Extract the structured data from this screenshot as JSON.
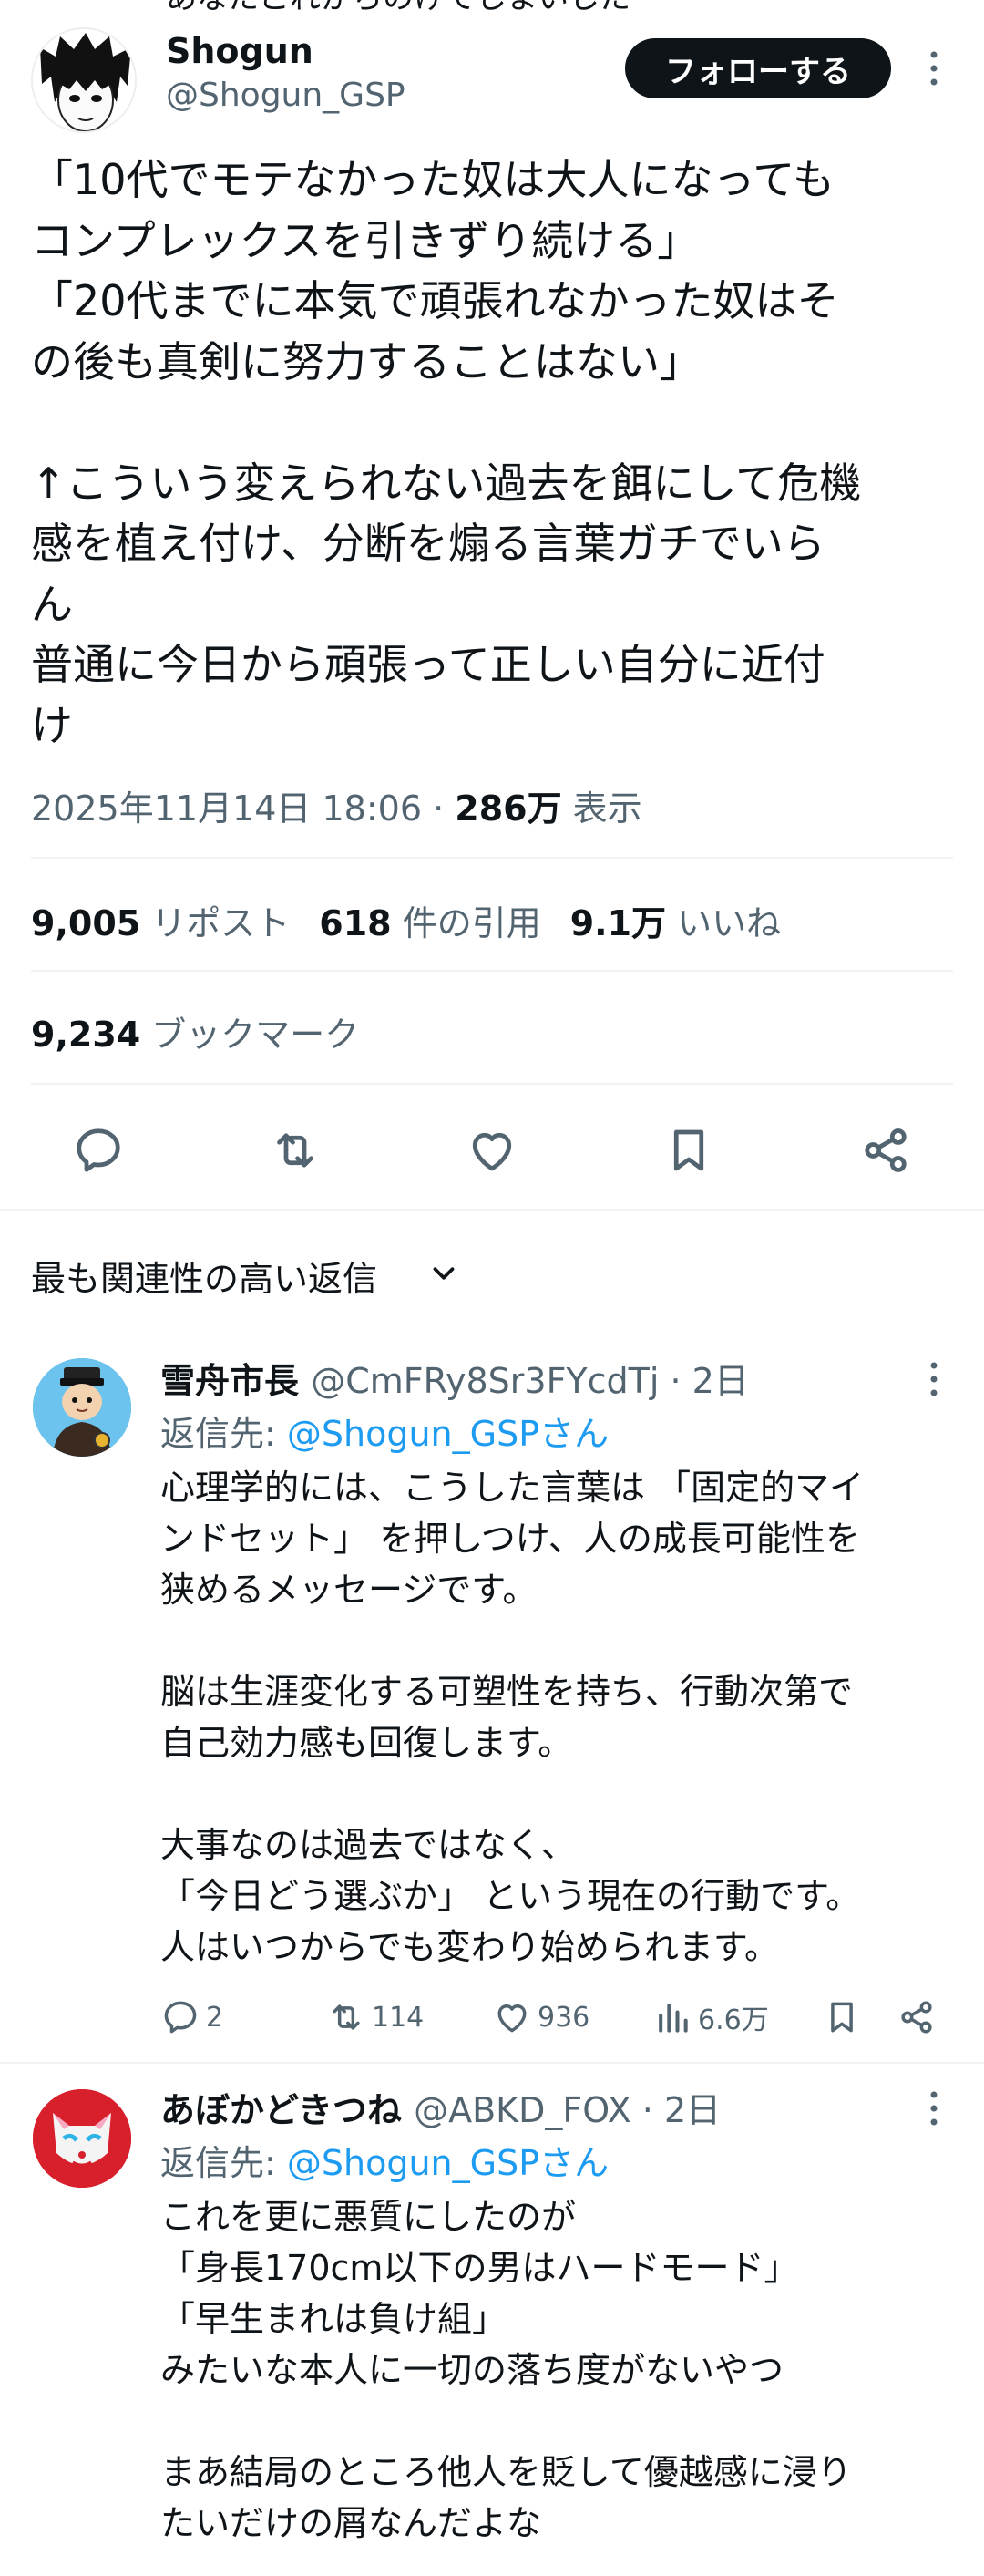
{
  "top_cut_text": "あなたこれからのけてしまいした",
  "tweet": {
    "author_name": "Shogun",
    "author_handle": "@Shogun_GSP",
    "follow_label": "フォローする",
    "text": "「10代でモテなかった奴は大人になっても\nコンプレックスを引きずり続ける」\n「20代までに本気で頑張れなかった奴はそ\nの後も真剣に努力することはない」\n\n↑こういう変えられない過去を餌にして危機\n感を植え付け、分断を煽る言葉ガチでいら\nん\n普通に今日から頑張って正しい自分に近付\nけ",
    "timestamp": "2025年11月14日 18:06",
    "separator": " · ",
    "views_count": "286万",
    "views_label": " 表示",
    "reposts_count": "9,005",
    "reposts_label": " リポスト",
    "quotes_count": "618",
    "quotes_label": " 件の引用",
    "likes_count": "9.1万",
    "likes_label": " いいね",
    "bookmarks_count": "9,234",
    "bookmarks_label": " ブックマーク",
    "actions": [
      "reply-icon",
      "retweet-icon",
      "heart-icon",
      "bookmark-icon",
      "share-icon"
    ]
  },
  "sort": {
    "label": "最も関連性の高い返信"
  },
  "replies": [
    {
      "name": "雪舟市長",
      "handle": "@CmFRy8Sr3FYcdTj · 2日",
      "reply_to_prefix": "返信先: ",
      "reply_to": "@Shogun_GSPさん",
      "text": "心理学的には、こうした言葉は 「固定的マイ\nンドセット」 を押しつけ、人の成長可能性を\n狭めるメッセージです。\n\n脳は生涯変化する可塑性を持ち、行動次第で\n自己効力感も回復します。\n\n大事なのは過去ではなく、\n「今日どう選ぶか」 という現在の行動です。\n人はいつからでも変わり始められます。",
      "replies": "2",
      "reposts": "114",
      "likes": "936",
      "views": "6.6万"
    },
    {
      "name": "あぼかどきつね",
      "handle": "@ABKD_FOX · 2日",
      "reply_to_prefix": "返信先: ",
      "reply_to": "@Shogun_GSPさん",
      "text": "これを更に悪質にしたのが\n「身長170cm以下の男はハードモード」\n「早生まれは負け組」\nみたいな本人に一切の落ち度がないやつ\n\nまあ結局のところ他人を貶して優越感に浸り\nたいだけの屑なんだよな"
    }
  ],
  "colors": {
    "text": "#0f1419",
    "secondary": "#536471",
    "link": "#1d9bf0",
    "divider": "#eff3f4",
    "button_bg": "#0f1419"
  }
}
